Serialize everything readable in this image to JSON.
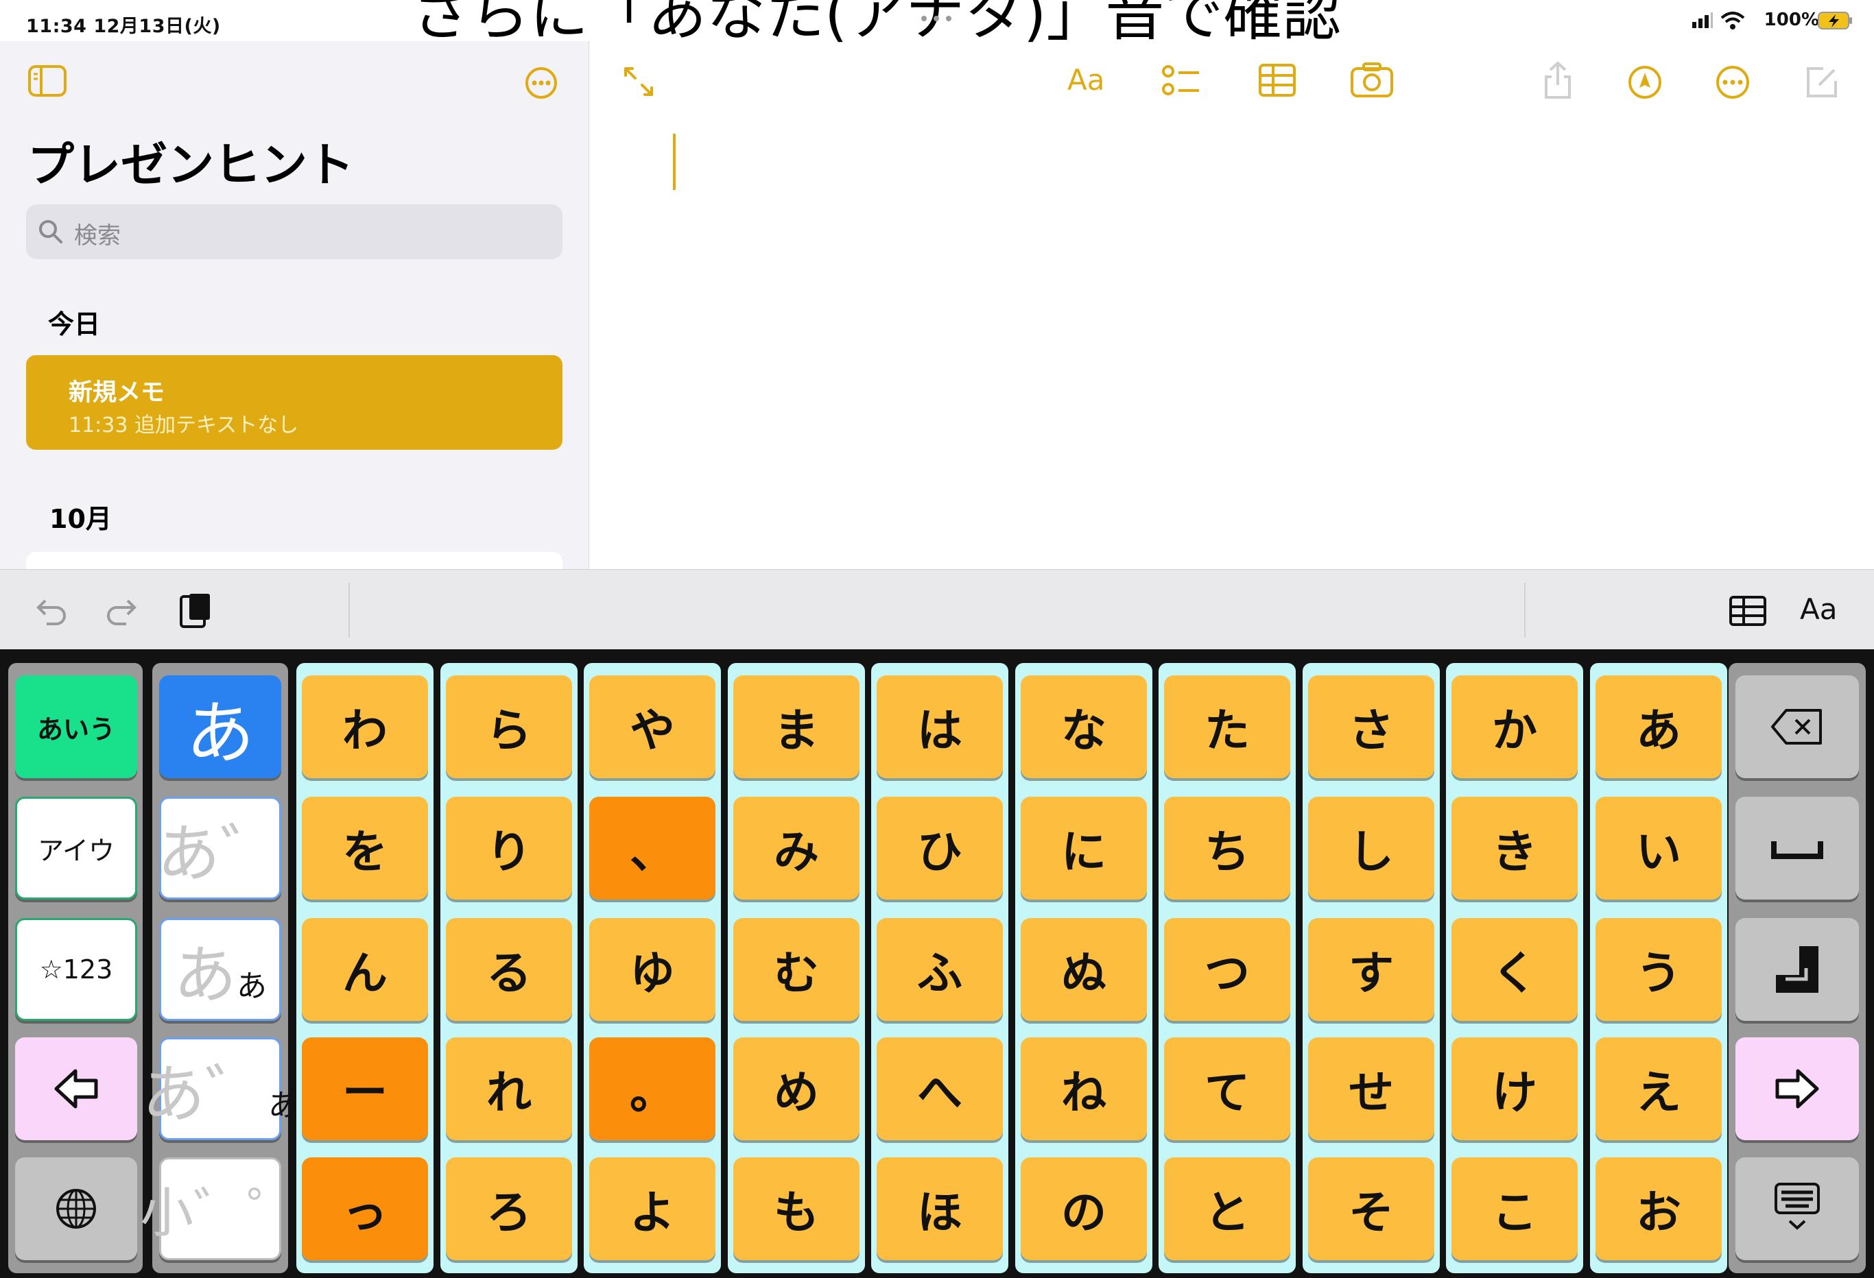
{
  "status": {
    "time_date": "11:34  12月13日(火)",
    "battery": "100%",
    "overlay_caption": "さらに「あなた(アナタ)」音で確認"
  },
  "sidebar": {
    "title": "プレゼンヒント",
    "search_placeholder": "検索",
    "section_today": "今日",
    "note": {
      "title": "新規メモ",
      "meta": "11:33  追加テキストなし"
    },
    "section_month": "10月"
  },
  "toolbar": {
    "format_label": "Aa",
    "kb_format_label": "Aa"
  },
  "keyboard": {
    "mode_keys": [
      "あいう",
      "アイウ",
      "☆123"
    ],
    "input_mode_keys": [
      {
        "big": "あ"
      },
      {
        "big": "あ゛"
      },
      {
        "big": "あ",
        "small": "あ"
      },
      {
        "big": "あ゛",
        "small": "あ"
      },
      {
        "big": "小゛゜"
      }
    ],
    "columns": [
      [
        "わ",
        "を",
        "ん",
        "ー",
        "っ"
      ],
      [
        "ら",
        "り",
        "る",
        "れ",
        "ろ"
      ],
      [
        "や",
        "、",
        "ゆ",
        "。",
        "よ"
      ],
      [
        "ま",
        "み",
        "む",
        "め",
        "も"
      ],
      [
        "は",
        "ひ",
        "ふ",
        "へ",
        "ほ"
      ],
      [
        "な",
        "に",
        "ぬ",
        "ね",
        "の"
      ],
      [
        "た",
        "ち",
        "つ",
        "て",
        "と"
      ],
      [
        "さ",
        "し",
        "す",
        "せ",
        "そ"
      ],
      [
        "か",
        "き",
        "く",
        "け",
        "こ"
      ],
      [
        "あ",
        "い",
        "う",
        "え",
        "お"
      ]
    ],
    "orange_keys": [
      "0-3",
      "0-4",
      "2-1",
      "2-3"
    ],
    "colors": {
      "kana": "#fdbe40",
      "punct": "#fb8e0b",
      "accent": "#e0ab12",
      "column_bg": "#c5f6f8"
    }
  }
}
